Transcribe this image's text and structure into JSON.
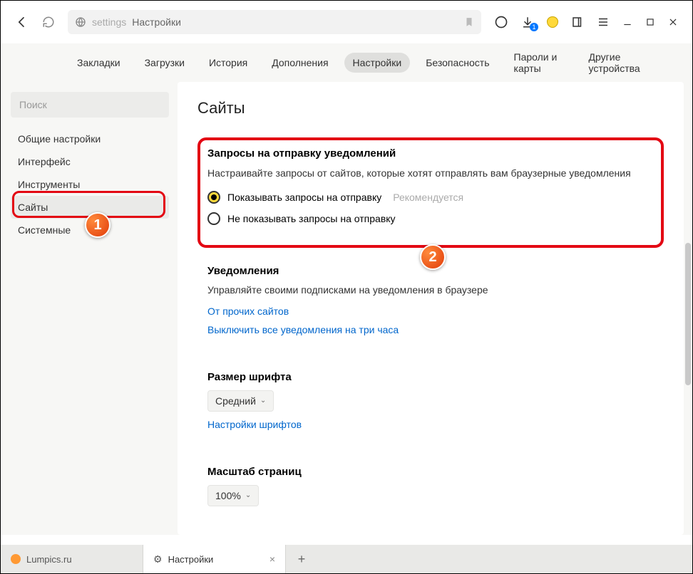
{
  "toolbar": {
    "address_prefix": "settings",
    "address_title": "Настройки"
  },
  "nav": {
    "bookmarks": "Закладки",
    "downloads": "Загрузки",
    "history": "История",
    "addons": "Дополнения",
    "settings": "Настройки",
    "security": "Безопасность",
    "passwords": "Пароли и карты",
    "other_devices": "Другие устройства"
  },
  "sidebar": {
    "search_placeholder": "Поиск",
    "general": "Общие настройки",
    "interface": "Интерфейс",
    "tools": "Инструменты",
    "sites": "Сайты",
    "system": "Системные"
  },
  "main": {
    "title": "Сайты",
    "notif_req": {
      "heading": "Запросы на отправку уведомлений",
      "desc": "Настраивайте запросы от сайтов, которые хотят отправлять вам браузерные уведомления",
      "opt_show": "Показывать запросы на отправку",
      "opt_show_hint": "Рекомендуется",
      "opt_hide": "Не показывать запросы на отправку"
    },
    "notif": {
      "heading": "Уведомления",
      "desc": "Управляйте своими подписками на уведомления в браузере",
      "link_others": "От прочих сайтов",
      "link_mute": "Выключить все уведомления на три часа"
    },
    "font": {
      "heading": "Размер шрифта",
      "value": "Средний",
      "link_settings": "Настройки шрифтов"
    },
    "zoom": {
      "heading": "Масштаб страниц",
      "value": "100%"
    }
  },
  "tabs": {
    "tab1": "Lumpics.ru",
    "tab2": "Настройки"
  },
  "badges": {
    "b1": "1",
    "b2": "2"
  }
}
